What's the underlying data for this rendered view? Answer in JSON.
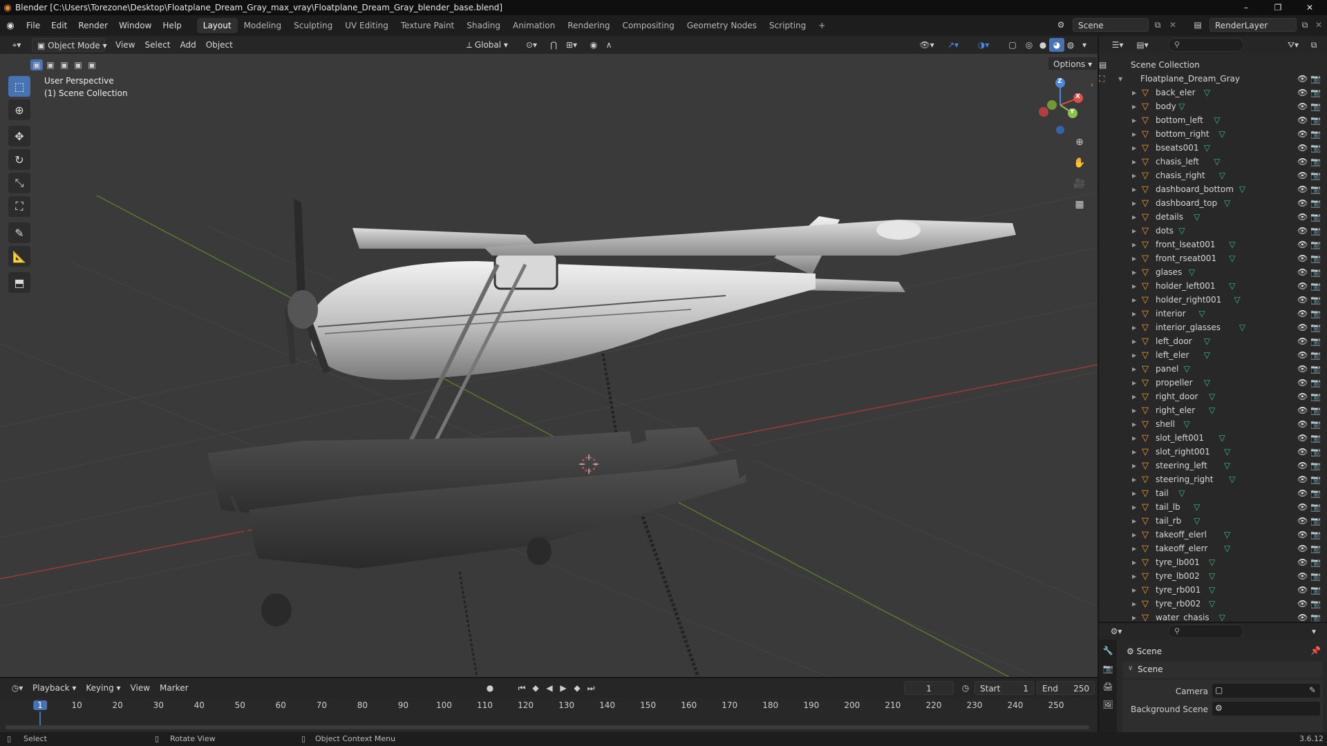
{
  "titlebar": {
    "title": "Blender [C:\\Users\\Torezone\\Desktop\\Floatplane_Dream_Gray_max_vray\\Floatplane_Dream_Gray_blender_base.blend]",
    "minimize": "–",
    "maximize": "❐",
    "close": "✕"
  },
  "menus": [
    "File",
    "Edit",
    "Render",
    "Window",
    "Help"
  ],
  "workspaces": [
    "Layout",
    "Modeling",
    "Sculpting",
    "UV Editing",
    "Texture Paint",
    "Shading",
    "Animation",
    "Rendering",
    "Compositing",
    "Geometry Nodes",
    "Scripting",
    "+"
  ],
  "active_workspace": "Layout",
  "scene_field": "Scene",
  "renderlayer_field": "RenderLayer",
  "viewport_header": {
    "mode": "Object Mode",
    "menus": [
      "View",
      "Select",
      "Add",
      "Object"
    ],
    "orientation": "Global",
    "options": "Options"
  },
  "viewport": {
    "perspective": "User Perspective",
    "collection": "(1) Scene Collection",
    "gizmo_axes": {
      "x": "X",
      "y": "Y",
      "z": "Z"
    }
  },
  "outliner": {
    "root": "Scene Collection",
    "collection": "Floatplane_Dream_Gray",
    "objects": [
      "back_eler",
      "body",
      "bottom_left",
      "bottom_right",
      "bseats001",
      "chasis_left",
      "chasis_right",
      "dashboard_bottom",
      "dashboard_top",
      "details",
      "dots",
      "front_lseat001",
      "front_rseat001",
      "glases",
      "holder_left001",
      "holder_right001",
      "interior",
      "interior_glasses",
      "left_door",
      "left_eler",
      "panel",
      "propeller",
      "right_door",
      "right_eler",
      "shell",
      "slot_left001",
      "slot_right001",
      "steering_left",
      "steering_right",
      "tail",
      "tail_lb",
      "tail_rb",
      "takeoff_elerl",
      "takeoff_elerr",
      "tyre_lb001",
      "tyre_lb002",
      "tyre_rb001",
      "tyre_rb002",
      "water_chasis"
    ]
  },
  "properties": {
    "header": "Scene",
    "panel": "Scene",
    "camera_label": "Camera",
    "background_label": "Background Scene"
  },
  "timeline": {
    "menus": [
      "Playback",
      "Keying",
      "View",
      "Marker"
    ],
    "current_frame": "1",
    "start_label": "Start",
    "start_value": "1",
    "end_label": "End",
    "end_value": "250",
    "ruler": [
      "1",
      "10",
      "20",
      "30",
      "40",
      "50",
      "60",
      "70",
      "80",
      "90",
      "100",
      "110",
      "120",
      "130",
      "140",
      "150",
      "160",
      "170",
      "180",
      "190",
      "200",
      "210",
      "220",
      "230",
      "240",
      "250"
    ]
  },
  "statusbar": {
    "select": "Select",
    "rotate": "Rotate View",
    "context": "Object Context Menu",
    "version": "3.6.12"
  },
  "colors": {
    "accent": "#4772b3",
    "mesh_icon": "#f39b33",
    "data_icon": "#37c27c",
    "axis_x": "#e04c4c",
    "axis_y": "#8bc34a",
    "axis_z": "#4a88e0"
  }
}
